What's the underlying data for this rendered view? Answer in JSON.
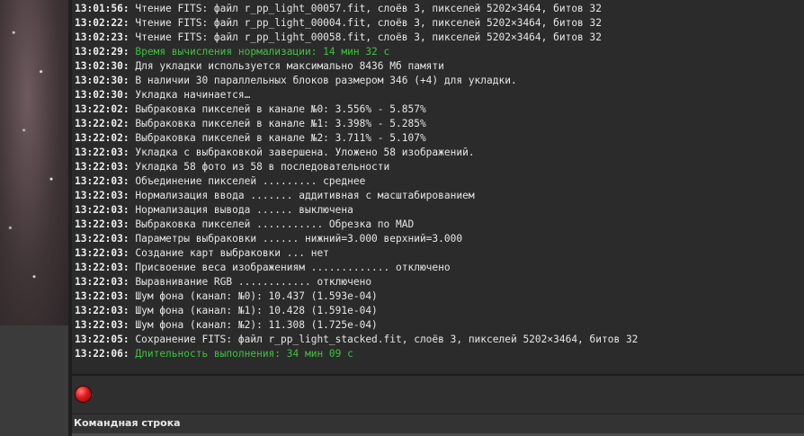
{
  "log": [
    {
      "time": "13:01:56:",
      "text": "Чтение FITS: файл r_pp_light_00057.fit, слоёв 3, пикселей 5202×3464, битов 32",
      "color": "white"
    },
    {
      "time": "13:02:22:",
      "text": "Чтение FITS: файл r_pp_light_00004.fit, слоёв 3, пикселей 5202×3464, битов 32",
      "color": "white"
    },
    {
      "time": "13:02:23:",
      "text": "Чтение FITS: файл r_pp_light_00058.fit, слоёв 3, пикселей 5202×3464, битов 32",
      "color": "white"
    },
    {
      "time": "13:02:29:",
      "text": "Время вычисления нормализации: 14 мин 32 с",
      "color": "green"
    },
    {
      "time": "13:02:30:",
      "text": "Для укладки используется максимально 8436 Мб памяти",
      "color": "white"
    },
    {
      "time": "13:02:30:",
      "text": "В наличии 30 параллельных блоков размером 346 (+4) для укладки.",
      "color": "white"
    },
    {
      "time": "13:02:30:",
      "text": "Укладка начинается…",
      "color": "white"
    },
    {
      "time": "13:22:02:",
      "text": "Выбраковка пикселей в канале №0: 3.556% - 5.857%",
      "color": "white"
    },
    {
      "time": "13:22:02:",
      "text": "Выбраковка пикселей в канале №1: 3.398% - 5.285%",
      "color": "white"
    },
    {
      "time": "13:22:02:",
      "text": "Выбраковка пикселей в канале №2: 3.711% - 5.107%",
      "color": "white"
    },
    {
      "time": "13:22:03:",
      "text": "Укладка с выбраковкой завершена. Уложено 58 изображений.",
      "color": "white"
    },
    {
      "time": "13:22:03:",
      "text": "Укладка 58 фото из 58 в последовательности",
      "color": "white"
    },
    {
      "time": "13:22:03:",
      "text": "Объединение пикселей ......... среднее",
      "color": "white"
    },
    {
      "time": "13:22:03:",
      "text": "Нормализация ввода ....... аддитивная с масштабированием",
      "color": "white"
    },
    {
      "time": "13:22:03:",
      "text": "Нормализация вывода ...... выключена",
      "color": "white"
    },
    {
      "time": "13:22:03:",
      "text": "Выбраковка пикселей ........... Обрезка по MAD",
      "color": "white"
    },
    {
      "time": "13:22:03:",
      "text": "Параметры выбраковки ...... нижний=3.000 верхний=3.000",
      "color": "white"
    },
    {
      "time": "13:22:03:",
      "text": "Создание карт выбраковки ... нет",
      "color": "white"
    },
    {
      "time": "13:22:03:",
      "text": "Присвоение веса изображениям ............. отключено",
      "color": "white"
    },
    {
      "time": "13:22:03:",
      "text": "Выравнивание RGB ............ отключено",
      "color": "white"
    },
    {
      "time": "13:22:03:",
      "text": "Шум фона (канал: №0): 10.437 (1.593e-04)",
      "color": "white"
    },
    {
      "time": "13:22:03:",
      "text": "Шум фона (канал: №1): 10.428 (1.591e-04)",
      "color": "white"
    },
    {
      "time": "13:22:03:",
      "text": "Шум фона (канал: №2): 11.308 (1.725e-04)",
      "color": "white"
    },
    {
      "time": "13:22:05:",
      "text": "Сохранение FITS: файл r_pp_light_stacked.fit, слоёв 3, пикселей 5202×3464, битов 32",
      "color": "white"
    },
    {
      "time": "13:22:06:",
      "text": "Длительность выполнения: 34 мин 09 с",
      "color": "green"
    }
  ],
  "stop_button": {
    "icon": "stop-icon",
    "color": "#e01818"
  },
  "command_line": {
    "label": "Командная строка"
  }
}
